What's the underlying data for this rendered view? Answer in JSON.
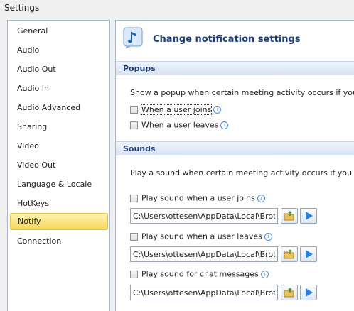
{
  "window": {
    "title": "Settings"
  },
  "sidebar": {
    "items": [
      {
        "label": "General"
      },
      {
        "label": "Audio"
      },
      {
        "label": "Audio Out"
      },
      {
        "label": "Audio In"
      },
      {
        "label": "Audio Advanced"
      },
      {
        "label": "Sharing"
      },
      {
        "label": "Video"
      },
      {
        "label": "Video Out"
      },
      {
        "label": "Language & Locale"
      },
      {
        "label": "HotKeys"
      },
      {
        "label": "Notify",
        "selected": true
      },
      {
        "label": "Connection"
      }
    ]
  },
  "header": {
    "title": "Change notification settings",
    "icon": "music-note-icon"
  },
  "popups": {
    "title": "Popups",
    "description": "Show a popup when certain meeting activity occurs if you are",
    "user_joins_label": "When a user joins",
    "user_leaves_label": "When a user leaves"
  },
  "sounds": {
    "title": "Sounds",
    "description": "Play a sound when certain meeting activity occurs if you are a",
    "join": {
      "label": "Play sound when a user joins",
      "path": "C:\\Users\\ottesen\\AppData\\Local\\Brothe"
    },
    "leave": {
      "label": "Play sound when a user leaves",
      "path": "C:\\Users\\ottesen\\AppData\\Local\\Brothe"
    },
    "chat": {
      "label": "Play sound for chat messages",
      "path": "C:\\Users\\ottesen\\AppData\\Local\\Brothe"
    }
  },
  "icons": {
    "info": "i",
    "browse": "folder-icon",
    "play": "play-icon"
  },
  "colors": {
    "accent": "#1e3f7b",
    "selected_bg": "#f6d959",
    "play": "#2b7fe0"
  }
}
